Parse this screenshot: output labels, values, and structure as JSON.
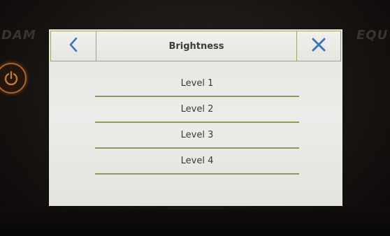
{
  "background_text": {
    "left": "DAM",
    "right": "EQU"
  },
  "header": {
    "back_icon": "chevron-left-icon",
    "title": "Brightness",
    "close_icon": "close-icon"
  },
  "levels": [
    {
      "label": "Level 1"
    },
    {
      "label": "Level 2"
    },
    {
      "label": "Level 3"
    },
    {
      "label": "Level 4"
    }
  ],
  "power_icon": "power-icon",
  "colors": {
    "accent_blue": "#3f73b8",
    "divider_green": "#8d9a5e",
    "power_orange": "#a9662a"
  }
}
